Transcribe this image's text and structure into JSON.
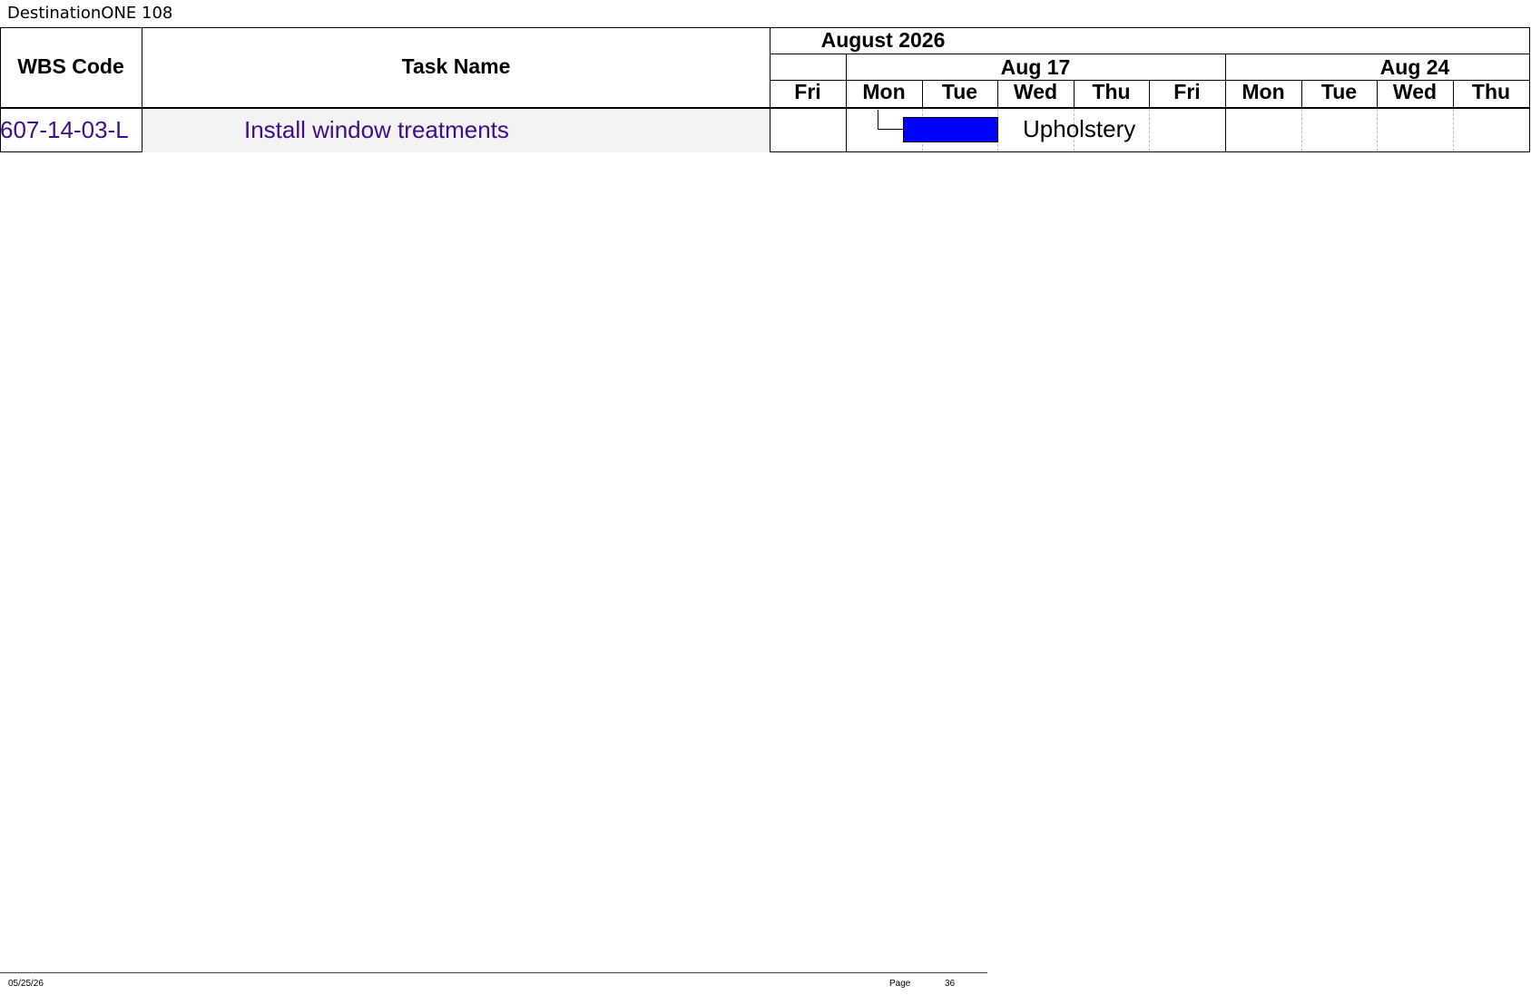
{
  "document": {
    "title": "DestinationONE 108"
  },
  "columns": {
    "wbs_code": "WBS Code",
    "task_name": "Task Name"
  },
  "timescale": {
    "month": "August 2026",
    "weeks": [
      "Aug 17",
      "Aug 24"
    ],
    "days": [
      "Fri",
      "Mon",
      "Tue",
      "Wed",
      "Thu",
      "Fri",
      "Mon",
      "Tue",
      "Wed",
      "Thu"
    ]
  },
  "rows": [
    {
      "wbs_code": "607-14-03-L",
      "task_name": "Install window treatments",
      "bar_start_day": "Mon",
      "bar_end_day": "Tue",
      "bar_label": "Upholstery"
    }
  ],
  "colors": {
    "bar_fill": "#0000ff",
    "task_text": "#3f0d8a",
    "row_bg": "#f3f3f3"
  },
  "footer": {
    "date": "05/25/26",
    "page_label": "Page",
    "page_number": "36"
  }
}
